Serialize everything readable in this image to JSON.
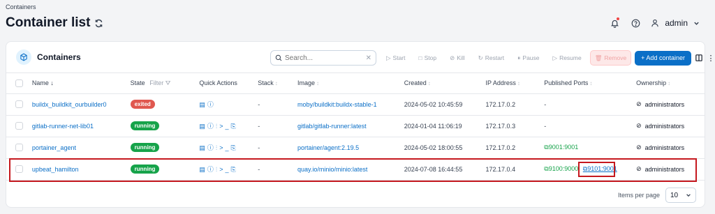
{
  "breadcrumb": "Containers",
  "page_title": "Container list",
  "user": {
    "name": "admin"
  },
  "card": {
    "title": "Containers",
    "search_placeholder": "Search...",
    "actions": {
      "start": "Start",
      "stop": "Stop",
      "kill": "Kill",
      "restart": "Restart",
      "pause": "Pause",
      "resume": "Resume",
      "remove": "Remove",
      "add": "+ Add container"
    }
  },
  "table": {
    "headers": {
      "name": "Name",
      "state": "State",
      "filter": "Filter",
      "quick_actions": "Quick Actions",
      "stack": "Stack",
      "image": "Image",
      "created": "Created",
      "ip": "IP Address",
      "ports": "Published Ports",
      "ownership": "Ownership"
    },
    "rows": [
      {
        "name": "buildx_buildkit_ourbuilder0",
        "state": "exited",
        "quick_actions": "logs inspect",
        "stack": "-",
        "image": "moby/buildkit:buildx-stable-1",
        "created": "2024-05-02 10:45:59",
        "ip": "172.17.0.2",
        "ports": "-",
        "ownership": "administrators"
      },
      {
        "name": "gitlab-runner-net-lib01",
        "state": "running",
        "quick_actions": "logs inspect stats console attach",
        "stack": "-",
        "image": "gitlab/gitlab-runner:latest",
        "created": "2024-01-04 11:06:19",
        "ip": "172.17.0.3",
        "ports": "-",
        "ownership": "administrators"
      },
      {
        "name": "portainer_agent",
        "state": "running",
        "quick_actions": "logs inspect stats console attach",
        "stack": "-",
        "image": "portainer/agent:2.19.5",
        "created": "2024-05-02 18:00:55",
        "ip": "172.17.0.2",
        "ports": "9001:9001",
        "ownership": "administrators"
      },
      {
        "name": "upbeat_hamilton",
        "state": "running",
        "quick_actions": "logs inspect stats console attach",
        "stack": "-",
        "image": "quay.io/minio/minio:latest",
        "created": "2024-07-08 16:44:55",
        "ip": "172.17.0.4",
        "ports": "9100:9000",
        "ports2": "9101:9001",
        "ownership": "administrators"
      }
    ]
  },
  "pagination": {
    "label": "Items per page",
    "value": "10"
  },
  "colors": {
    "accent": "#0b6fc7",
    "running": "#16a34a",
    "exited": "#e0584f",
    "highlight": "#c5181e"
  }
}
